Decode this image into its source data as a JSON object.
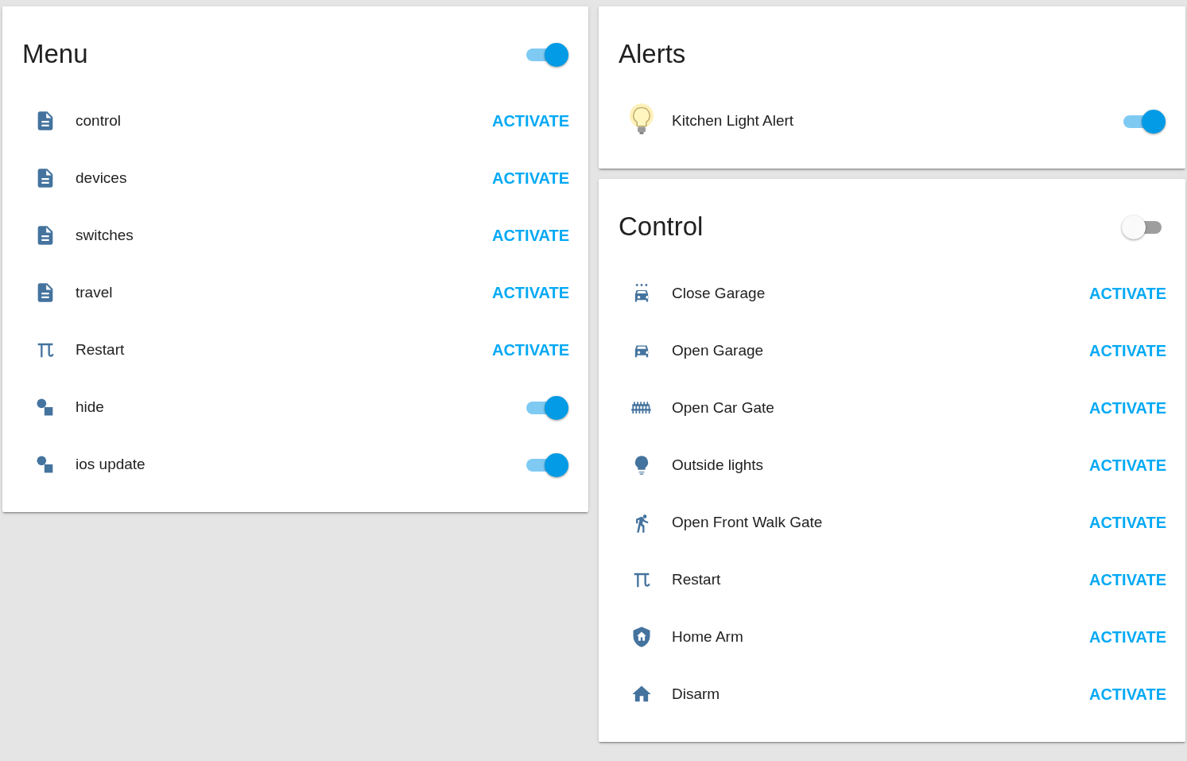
{
  "columns": [
    {
      "cards": [
        {
          "title": "Menu",
          "toggle": {
            "on": true
          },
          "rows": [
            {
              "kind": "button",
              "name": "control",
              "action": "ACTIVATE"
            },
            {
              "kind": "button",
              "name": "devices",
              "action": "ACTIVATE"
            },
            {
              "kind": "button",
              "name": "switches",
              "action": "ACTIVATE"
            },
            {
              "kind": "button",
              "name": "travel",
              "action": "ACTIVATE"
            },
            {
              "kind": "button",
              "name": "Restart",
              "action": "ACTIVATE"
            },
            {
              "kind": "toggle",
              "name": "hide",
              "on": true
            },
            {
              "kind": "toggle",
              "name": "ios update",
              "on": true
            }
          ]
        }
      ]
    },
    {
      "cards": [
        {
          "title": "Alerts",
          "rows": [
            {
              "kind": "toggle",
              "name": "Kitchen Light Alert",
              "on": true
            }
          ]
        },
        {
          "title": "Control",
          "toggle": {
            "on": false
          },
          "rows": [
            {
              "kind": "button",
              "name": "Close Garage",
              "action": "ACTIVATE"
            },
            {
              "kind": "button",
              "name": "Open Garage",
              "action": "ACTIVATE"
            },
            {
              "kind": "button",
              "name": "Open Car Gate",
              "action": "ACTIVATE"
            },
            {
              "kind": "button",
              "name": "Outside lights",
              "action": "ACTIVATE"
            },
            {
              "kind": "button",
              "name": "Open Front Walk Gate",
              "action": "ACTIVATE"
            },
            {
              "kind": "button",
              "name": "Restart",
              "action": "ACTIVATE"
            },
            {
              "kind": "button",
              "name": "Home Arm",
              "action": "ACTIVATE"
            },
            {
              "kind": "button",
              "name": "Disarm",
              "action": "ACTIVATE"
            }
          ]
        }
      ]
    }
  ]
}
